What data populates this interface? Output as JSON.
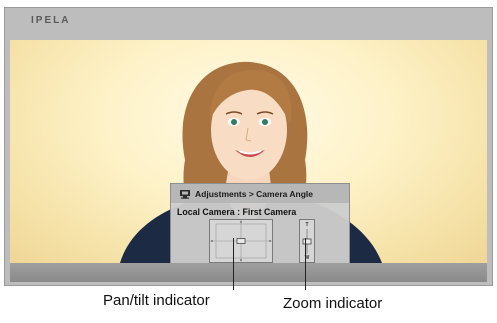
{
  "header": {
    "brand": "IPELA"
  },
  "osd": {
    "title": "Adjustments > Camera Angle",
    "subtitle": "Local Camera : First Camera",
    "zoom_tele": "T",
    "zoom_wide": "W",
    "pantilt_level": {
      "pan": 0.0,
      "tilt": 0.0
    },
    "zoom_level": 0.5
  },
  "callouts": {
    "pantilt": "Pan/tilt indicator",
    "zoom": "Zoom indicator"
  },
  "colors": {
    "frame": "#bdbdbd",
    "screen_bg": "#fdf1c6",
    "osd_bg": "#cdcdcd",
    "jacket": "#1d2a44"
  }
}
